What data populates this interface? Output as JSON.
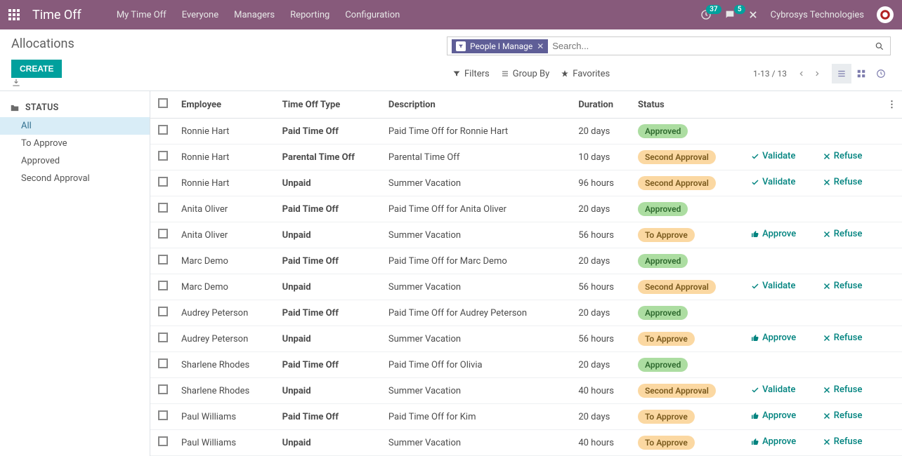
{
  "navbar": {
    "brand": "Time Off",
    "links": [
      "My Time Off",
      "Everyone",
      "Managers",
      "Reporting",
      "Configuration"
    ],
    "activity_count": "37",
    "message_count": "5",
    "company": "Cybrosys Technologies"
  },
  "header": {
    "title": "Allocations",
    "create_label": "CREATE",
    "filter_chip": "People I Manage",
    "search_placeholder": "Search...",
    "filters_label": "Filters",
    "group_by_label": "Group By",
    "favorites_label": "Favorites",
    "pager": "1-13 / 13"
  },
  "sidebar": {
    "header": "STATUS",
    "items": [
      "All",
      "To Approve",
      "Approved",
      "Second Approval"
    ],
    "active_index": 0
  },
  "table": {
    "columns": [
      "Employee",
      "Time Off Type",
      "Description",
      "Duration",
      "Status"
    ],
    "actions": {
      "validate": "Validate",
      "refuse": "Refuse",
      "approve": "Approve"
    },
    "status_colors": {
      "Approved": "#ACDDA1",
      "Second Approval": "#FBD8A2",
      "To Approve": "#FBD8A2"
    },
    "rows": [
      {
        "employee": "Ronnie Hart",
        "type": "Paid Time Off",
        "description": "Paid Time Off for Ronnie Hart",
        "duration": "20 days",
        "status": "Approved",
        "actions": []
      },
      {
        "employee": "Ronnie Hart",
        "type": "Parental Time Off",
        "description": "Parental Time Off",
        "duration": "10 days",
        "status": "Second Approval",
        "actions": [
          "validate",
          "refuse"
        ]
      },
      {
        "employee": "Ronnie Hart",
        "type": "Unpaid",
        "description": "Summer Vacation",
        "duration": "96 hours",
        "status": "Second Approval",
        "actions": [
          "validate",
          "refuse"
        ]
      },
      {
        "employee": "Anita Oliver",
        "type": "Paid Time Off",
        "description": "Paid Time Off for Anita Oliver",
        "duration": "20 days",
        "status": "Approved",
        "actions": []
      },
      {
        "employee": "Anita Oliver",
        "type": "Unpaid",
        "description": "Summer Vacation",
        "duration": "56 hours",
        "status": "To Approve",
        "actions": [
          "approve",
          "refuse"
        ]
      },
      {
        "employee": "Marc Demo",
        "type": "Paid Time Off",
        "description": "Paid Time Off for Marc Demo",
        "duration": "20 days",
        "status": "Approved",
        "actions": []
      },
      {
        "employee": "Marc Demo",
        "type": "Unpaid",
        "description": "Summer Vacation",
        "duration": "56 hours",
        "status": "Second Approval",
        "actions": [
          "validate",
          "refuse"
        ]
      },
      {
        "employee": "Audrey Peterson",
        "type": "Paid Time Off",
        "description": "Paid Time Off for Audrey Peterson",
        "duration": "20 days",
        "status": "Approved",
        "actions": []
      },
      {
        "employee": "Audrey Peterson",
        "type": "Unpaid",
        "description": "Summer Vacation",
        "duration": "56 hours",
        "status": "To Approve",
        "actions": [
          "approve",
          "refuse"
        ]
      },
      {
        "employee": "Sharlene Rhodes",
        "type": "Paid Time Off",
        "description": "Paid Time Off for Olivia",
        "duration": "20 days",
        "status": "Approved",
        "actions": []
      },
      {
        "employee": "Sharlene Rhodes",
        "type": "Unpaid",
        "description": "Summer Vacation",
        "duration": "40 hours",
        "status": "Second Approval",
        "actions": [
          "validate",
          "refuse"
        ]
      },
      {
        "employee": "Paul Williams",
        "type": "Paid Time Off",
        "description": "Paid Time Off for Kim",
        "duration": "20 days",
        "status": "To Approve",
        "actions": [
          "approve",
          "refuse"
        ]
      },
      {
        "employee": "Paul Williams",
        "type": "Unpaid",
        "description": "Summer Vacation",
        "duration": "40 hours",
        "status": "To Approve",
        "actions": [
          "approve",
          "refuse"
        ]
      }
    ]
  }
}
